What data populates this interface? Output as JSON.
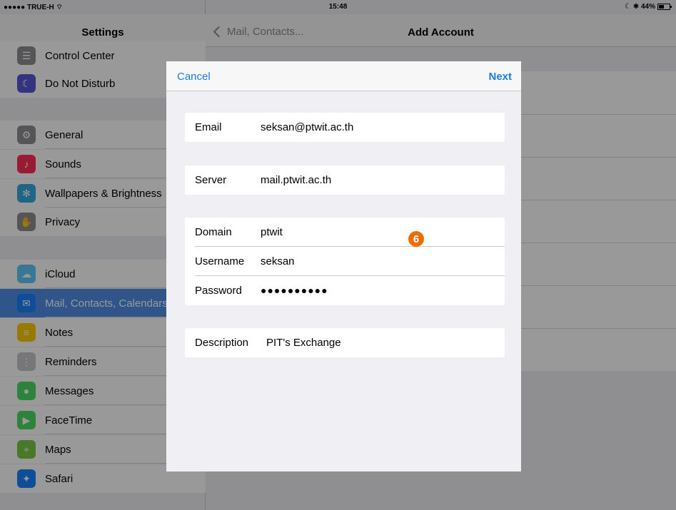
{
  "status_bar": {
    "carrier": "●●●●● TRUE-H ⌔",
    "time": "15:48",
    "battery": "☾ ✱ 44%"
  },
  "sidebar": {
    "title": "Settings",
    "items": [
      {
        "label": "Control Center",
        "icon": "control-center-icon",
        "color": "#8e8e93",
        "glyph": "☰"
      },
      {
        "label": "Do Not Disturb",
        "icon": "moon-icon",
        "color": "#5856d6",
        "glyph": "☾"
      },
      {
        "label": "General",
        "icon": "gear-icon",
        "color": "#8e8e93",
        "glyph": "⚙"
      },
      {
        "label": "Sounds",
        "icon": "speaker-icon",
        "color": "#ff2d55",
        "glyph": "♪"
      },
      {
        "label": "Wallpapers & Brightness",
        "icon": "wallpaper-icon",
        "color": "#34aadc",
        "glyph": "✻"
      },
      {
        "label": "Privacy",
        "icon": "hand-icon",
        "color": "#8e8e93",
        "glyph": "✋"
      },
      {
        "label": "iCloud",
        "icon": "cloud-icon",
        "color": "#5ac8fa",
        "glyph": "☁"
      },
      {
        "label": "Mail, Contacts, Calendars",
        "icon": "mail-icon",
        "color": "#1a82fb",
        "glyph": "✉"
      },
      {
        "label": "Notes",
        "icon": "notes-icon",
        "color": "#ffcc00",
        "glyph": "≡"
      },
      {
        "label": "Reminders",
        "icon": "reminders-icon",
        "color": "#c7c7cc",
        "glyph": "⋮"
      },
      {
        "label": "Messages",
        "icon": "messages-icon",
        "color": "#4cd964",
        "glyph": "●"
      },
      {
        "label": "FaceTime",
        "icon": "facetime-icon",
        "color": "#4cd964",
        "glyph": "▶"
      },
      {
        "label": "Maps",
        "icon": "maps-icon",
        "color": "#7ac943",
        "glyph": "⌖"
      },
      {
        "label": "Safari",
        "icon": "compass-icon",
        "color": "#1a82fb",
        "glyph": "✦"
      }
    ]
  },
  "detail": {
    "back_label": "Mail, Contacts...",
    "title": "Add Account"
  },
  "modal": {
    "cancel_label": "Cancel",
    "next_label": "Next",
    "email": {
      "label": "Email",
      "value": "seksan@ptwit.ac.th"
    },
    "server": {
      "label": "Server",
      "value": "mail.ptwit.ac.th"
    },
    "domain": {
      "label": "Domain",
      "value": "ptwit"
    },
    "username": {
      "label": "Username",
      "value": "seksan"
    },
    "password": {
      "label": "Password",
      "value": "●●●●●●●●●●"
    },
    "description": {
      "label": "Description",
      "value": "PIT's Exchange"
    }
  },
  "step_badge": "6",
  "colors": {
    "accent": "#1a7de6",
    "badge": "#ef6c00",
    "selected_row": "#4f8ee8"
  }
}
